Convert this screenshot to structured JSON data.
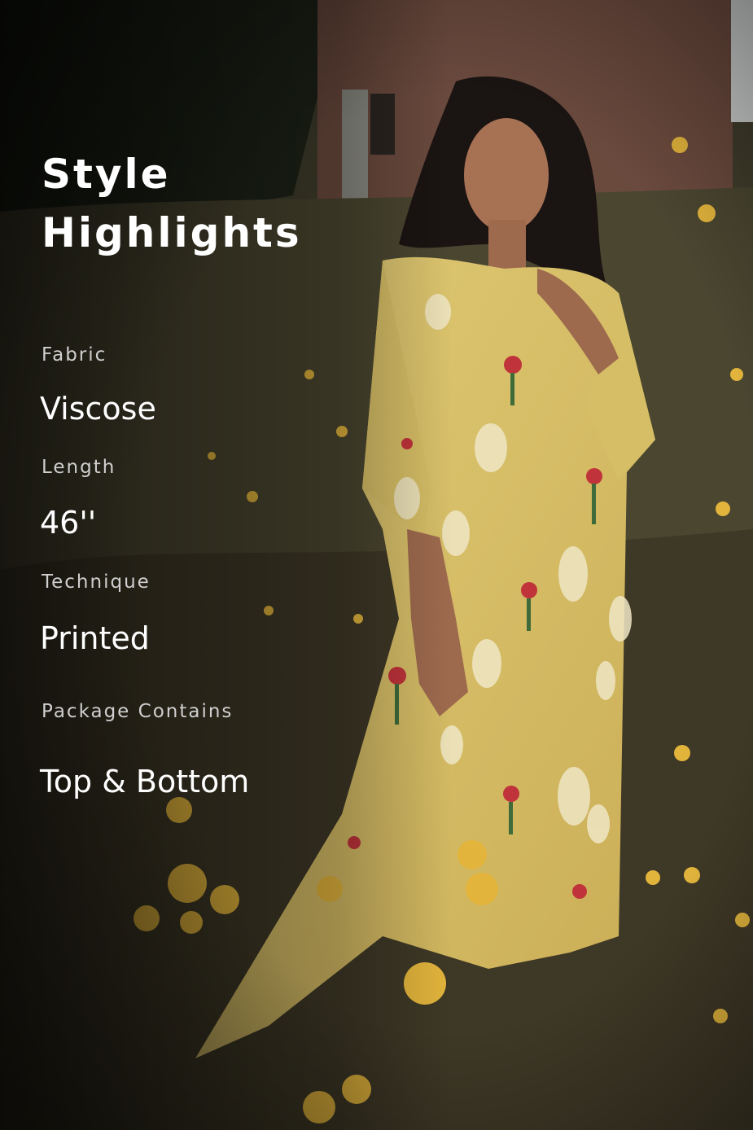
{
  "title_line1": "Style",
  "title_line2": "Highlights",
  "specs": [
    {
      "label": "Fabric",
      "value": "Viscose"
    },
    {
      "label": "Length",
      "value": "46''"
    },
    {
      "label": "Technique",
      "value": "Printed"
    },
    {
      "label": "Package Contains",
      "value": "Top & Bottom"
    }
  ],
  "photo": {
    "subject": "woman in a yellow floral kurta standing in a field of wildflowers",
    "colors": {
      "kurta": "#d8c067",
      "foliage": "#4a4a2c",
      "wall": "#6e4a40",
      "flowers": "#e2b43c"
    }
  }
}
